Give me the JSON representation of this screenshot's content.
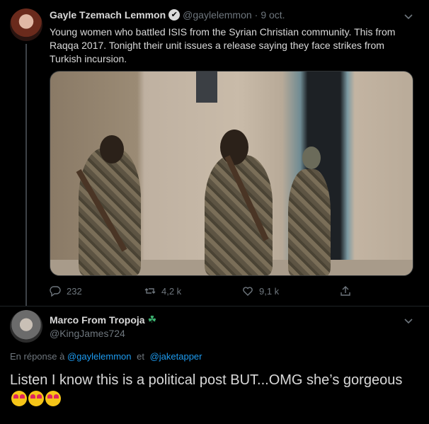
{
  "tweet": {
    "author_name": "Gayle Tzemach Lemmon",
    "handle": "@gaylelemmon",
    "separator": "·",
    "date": "9 oct.",
    "text": "Young women who battled ISIS from the Syrian Christian community. This from Raqqa 2017. Tonight their unit issues a release saying they face strikes from Turkish incursion.",
    "actions": {
      "replies": "232",
      "retweets": "4,2 k",
      "likes": "9,1 k"
    }
  },
  "reply": {
    "author_name": "Marco From Tropoja",
    "badge": "☘",
    "handle": "@KingJames724",
    "in_reply_prefix": "En réponse à",
    "mention_1": "@gaylelemmon",
    "conjunction": "et",
    "mention_2": "@jaketapper",
    "text": "Listen I know this is a political post BUT...OMG she’s gorgeous"
  },
  "icons": {
    "verified": "verified-badge-icon",
    "caret": "chevron-down-icon",
    "reply": "comment-icon",
    "retweet": "retweet-icon",
    "like": "heart-icon",
    "share": "share-icon",
    "emoji": "heart-eyes-emoji"
  },
  "colors": {
    "background": "#000000",
    "text": "#d9d9d9",
    "muted": "#6e767d",
    "link": "#1d9bf0"
  }
}
